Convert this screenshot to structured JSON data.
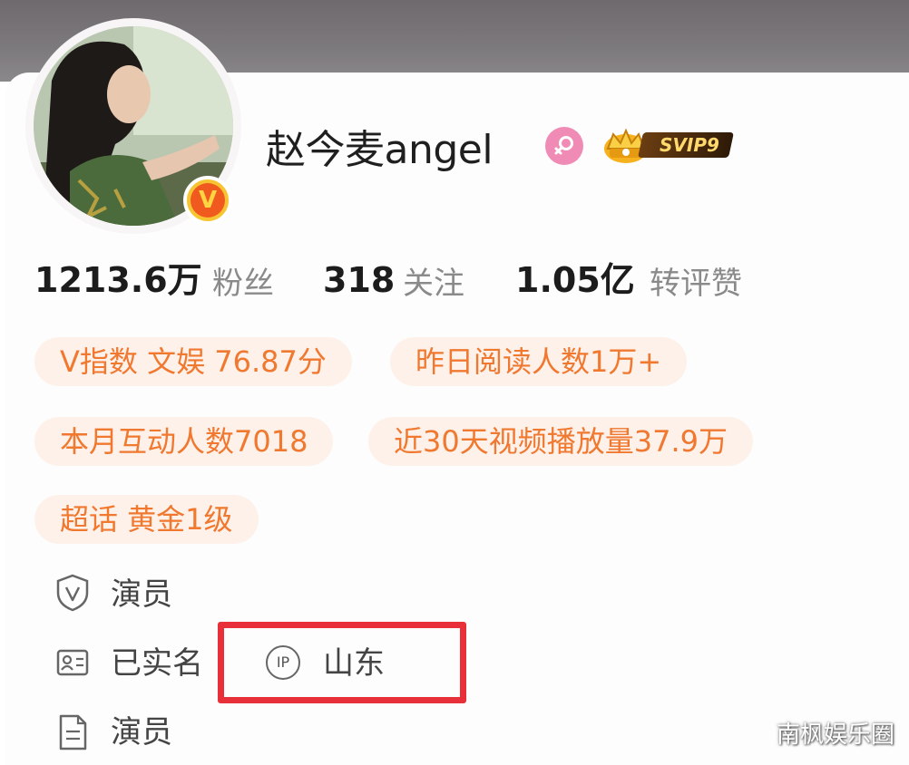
{
  "profile": {
    "username": "赵今麦angel",
    "verified_badge": "V",
    "gender_icon": "female-icon",
    "vip_level": "SVIP9"
  },
  "stats": {
    "followers_value": "1213.6万",
    "followers_label": "粉丝",
    "following_value": "318",
    "following_label": "关注",
    "likes_value": "1.05亿",
    "likes_label": "转评赞"
  },
  "tags": [
    "V指数 文娱 76.87分",
    "昨日阅读人数1万+",
    "本月互动人数7018",
    "近30天视频播放量37.9万",
    "超话 黄金1级"
  ],
  "info": {
    "occupation": "演员",
    "real_name_status": "已实名",
    "ip_badge": "IP",
    "ip_location": "山东",
    "bio": "演员"
  },
  "watermark": "南枫娱乐圈",
  "colors": {
    "tag_text": "#f0782f",
    "tag_bg": "#fdf1ea",
    "highlight_border": "#e8303a",
    "gender_bg": "#f08bb6"
  }
}
